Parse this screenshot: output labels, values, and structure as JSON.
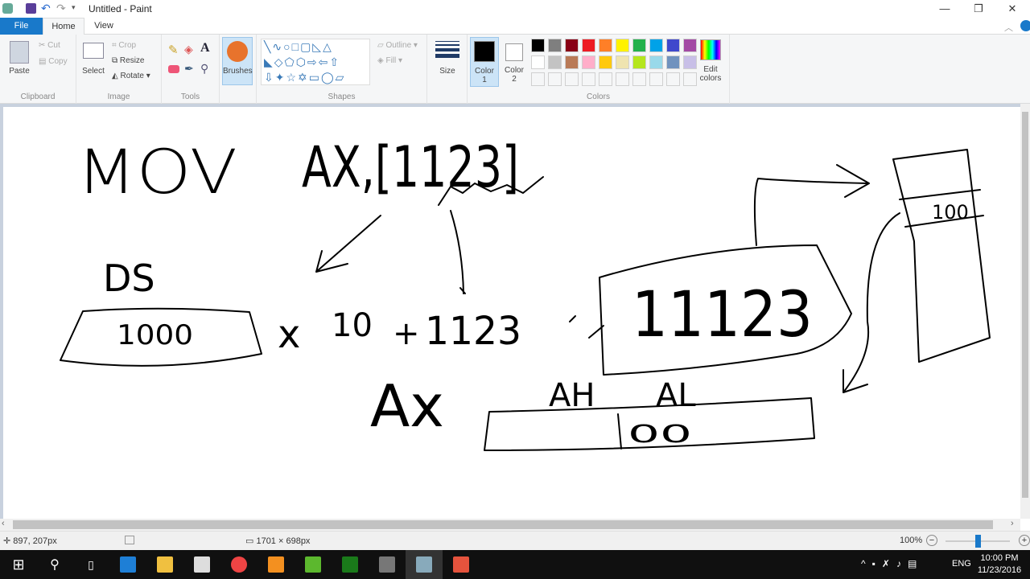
{
  "window": {
    "title": "Untitled - Paint",
    "minimize": "—",
    "restore": "❐",
    "close": "✕"
  },
  "tabs": [
    {
      "label": "File"
    },
    {
      "label": "Home"
    },
    {
      "label": "View"
    }
  ],
  "ribbon": {
    "clipboard": {
      "paste": "Paste",
      "cut": "Cut",
      "copy": "Copy",
      "group": "Clipboard"
    },
    "image": {
      "select": "Select",
      "crop": "Crop",
      "resize": "Resize",
      "rotate": "Rotate",
      "group": "Image"
    },
    "tools": {
      "group": "Tools"
    },
    "brushes": {
      "label": "Brushes"
    },
    "shapes": {
      "outline": "Outline",
      "fill": "Fill",
      "group": "Shapes"
    },
    "size": {
      "label": "Size"
    },
    "color1": {
      "label": "Color",
      "sub": "1",
      "value": "#000000"
    },
    "color2": {
      "label": "Color",
      "sub": "2",
      "value": "#ffffff"
    },
    "colors": {
      "group": "Colors",
      "edit": "Edit",
      "edit2": "colors",
      "row1": [
        "#000000",
        "#7f7f7f",
        "#880015",
        "#ed1c24",
        "#ff7f27",
        "#fff200",
        "#22b14c",
        "#00a2e8",
        "#3f48cc",
        "#a349a4"
      ],
      "row2": [
        "#ffffff",
        "#c3c3c3",
        "#b97a57",
        "#ffaec9",
        "#ffc90e",
        "#efe4b0",
        "#b5e61d",
        "#99d9ea",
        "#7092be",
        "#c8bfe7"
      ]
    }
  },
  "drawing": {
    "mov": "MOV",
    "ax_op": "AX,[1123]",
    "ds": "DS",
    "ds_val": "1000",
    "times": "x",
    "ten": "10",
    "plus": "+",
    "offset": "1123",
    "ax": "Ax",
    "ah": "AH",
    "al": "AL",
    "al_val": "00",
    "addr": "11123",
    "mem_val": "100"
  },
  "status": {
    "cursor": "897, 207px",
    "size": "1701 × 698px",
    "zoom": "100%",
    "zoom_level": 0.5
  },
  "taskbar": {
    "lang": "ENG",
    "time": "10:00 PM",
    "date": "11/23/2016"
  }
}
